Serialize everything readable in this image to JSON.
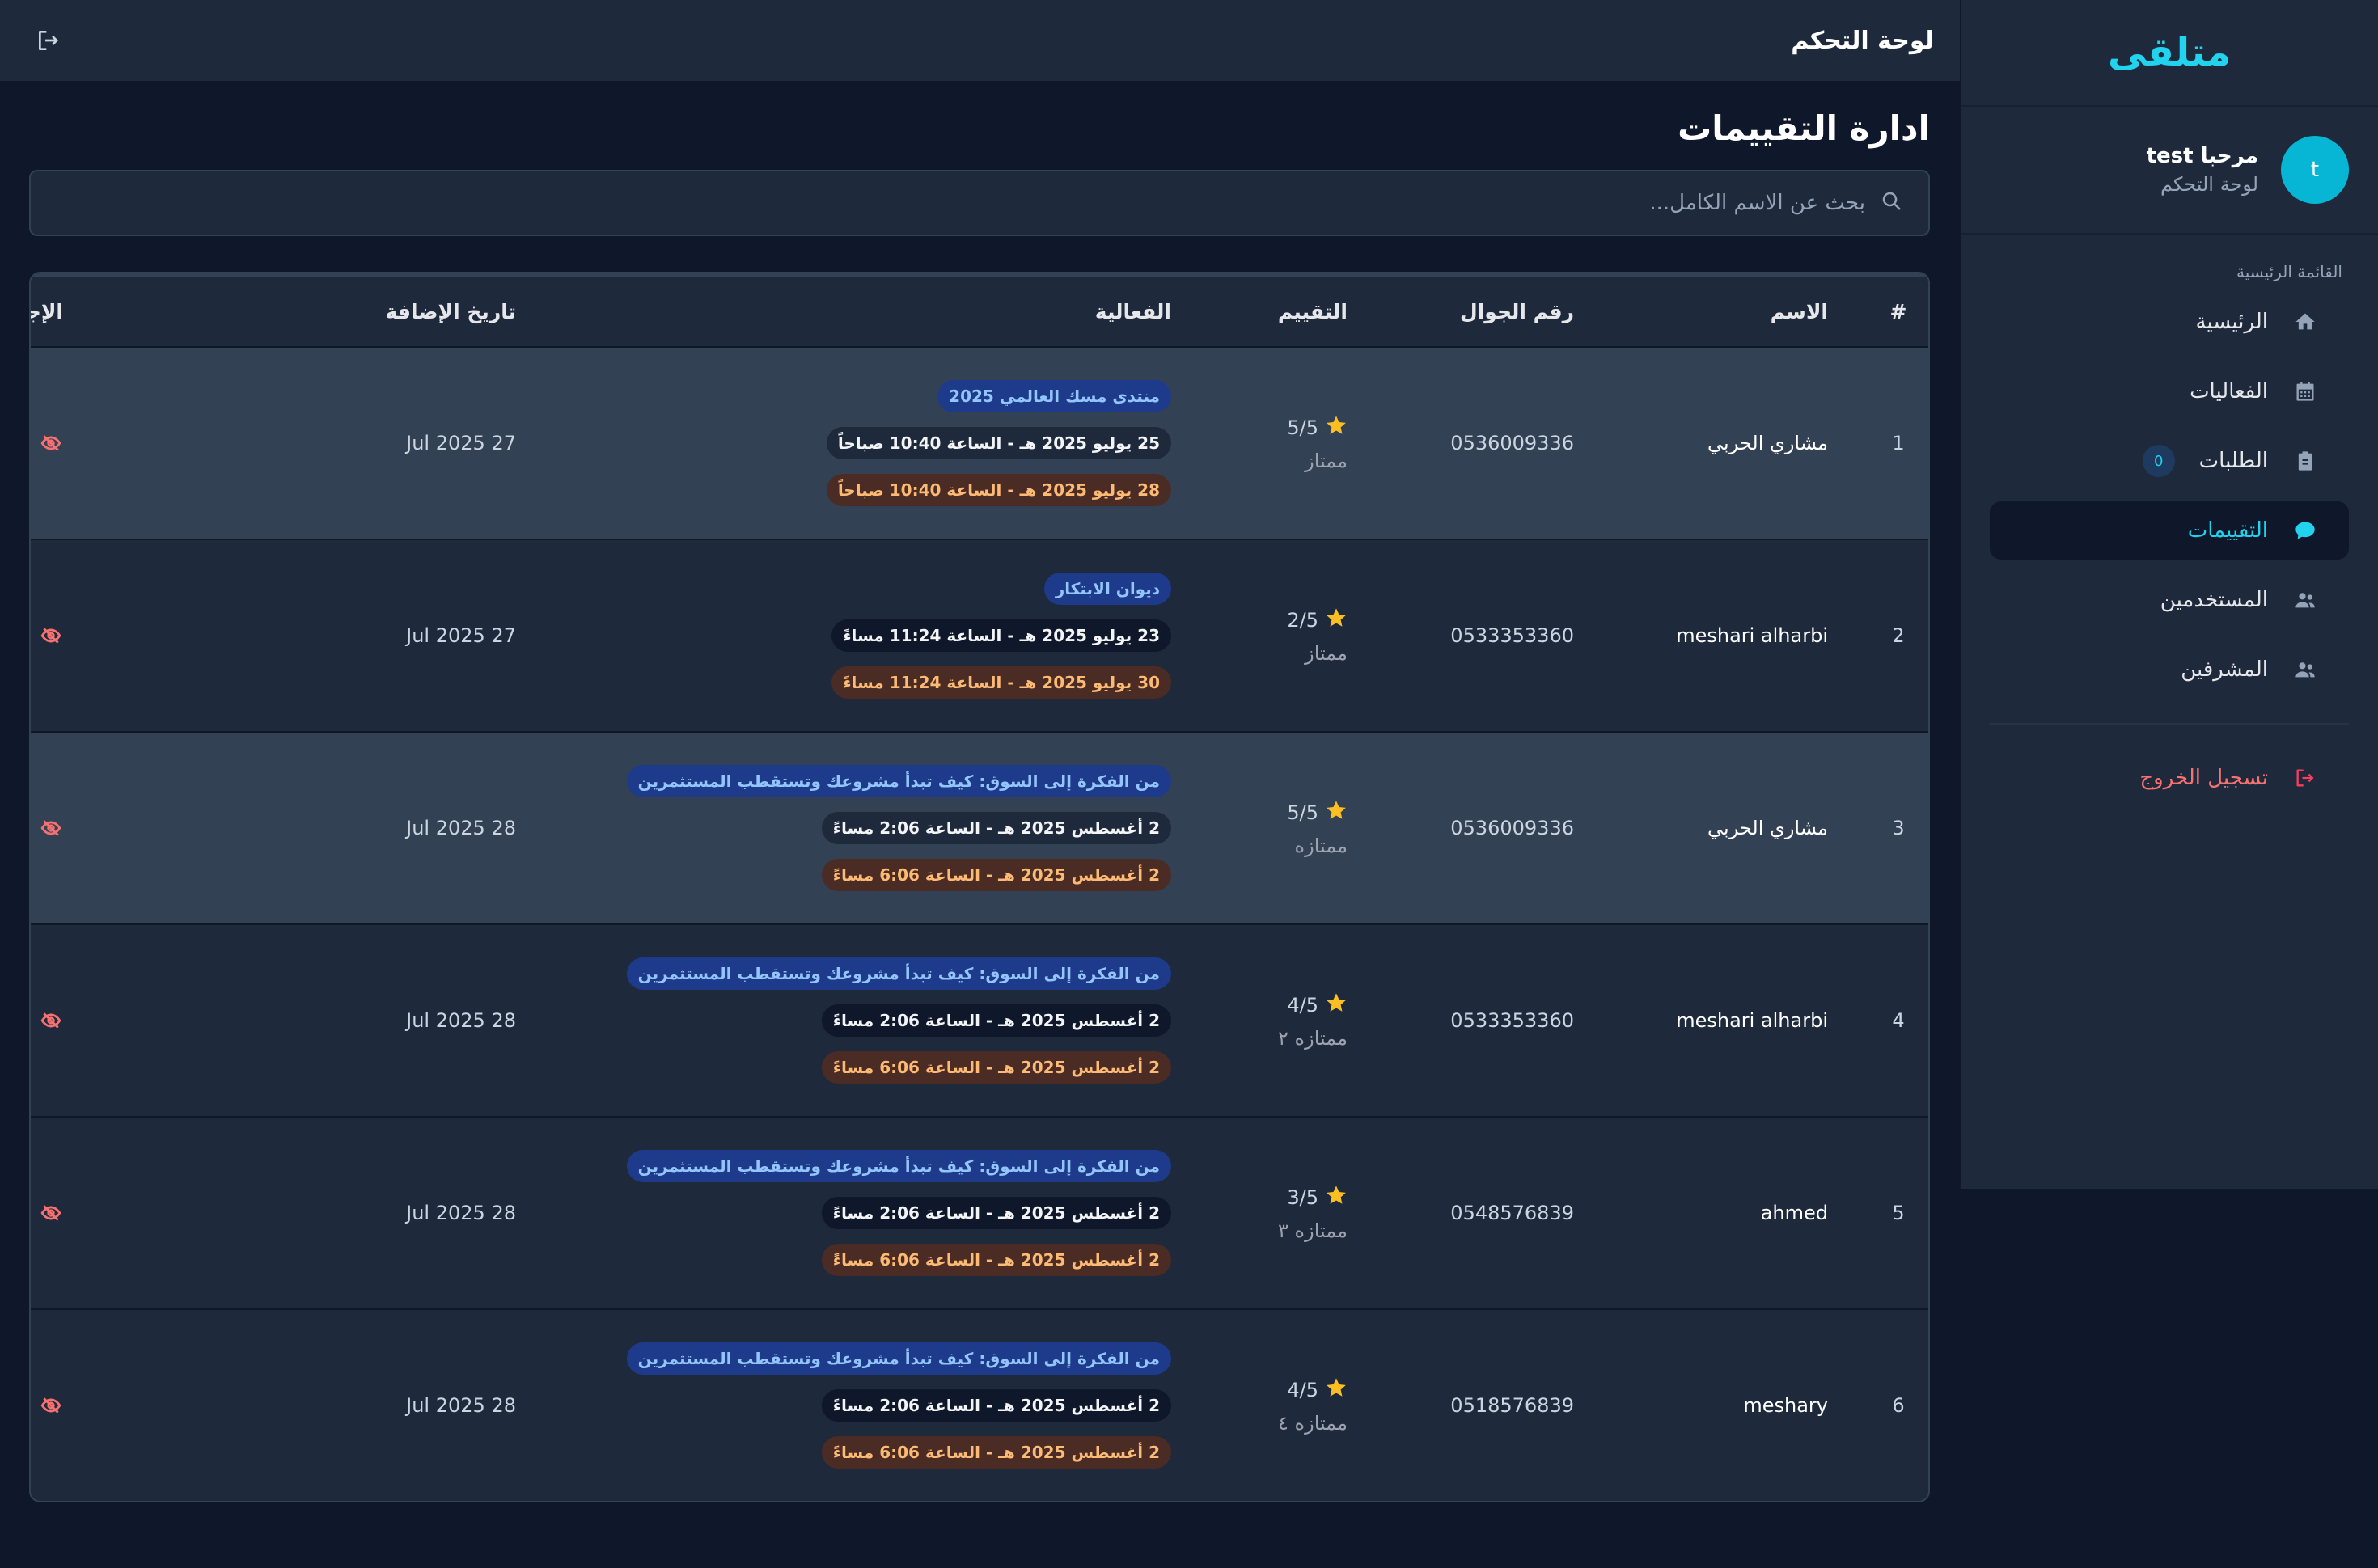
{
  "app": {
    "brand": "متلقى"
  },
  "topbar": {
    "title": "لوحة التحكم",
    "exit_icon": "exit-icon"
  },
  "profile": {
    "avatar_letter": "t",
    "greeting": "مرحبا test",
    "subtitle": "لوحة التحكم"
  },
  "sidebar": {
    "heading": "القائمة الرئيسية",
    "items": [
      {
        "label": "الرئيسية",
        "icon": "home-icon",
        "active": false
      },
      {
        "label": "الفعاليات",
        "icon": "calendar-icon",
        "active": false
      },
      {
        "label": "الطلبات",
        "icon": "clipboard-icon",
        "active": false,
        "badge": "0"
      },
      {
        "label": "التقييمات",
        "icon": "comment-icon",
        "active": true
      },
      {
        "label": "المستخدمين",
        "icon": "users-icon",
        "active": false
      },
      {
        "label": "المشرفين",
        "icon": "users-icon",
        "active": false
      }
    ],
    "logout": "تسجيل الخروج"
  },
  "page": {
    "title": "ادارة التقييمات",
    "search_placeholder": "بحث عن الاسم الكامل..."
  },
  "table": {
    "headers": {
      "num": "#",
      "name": "الاسم",
      "phone": "رقم الجوال",
      "rating": "التقييم",
      "event": "الفعالية",
      "date": "تاريخ الإضافة",
      "actions": "الإجراءات"
    },
    "rows": [
      {
        "num": "1",
        "name": "مشاري الحربي",
        "phone": "0536009336",
        "rating": "5/5",
        "rating_label": "ممتاز",
        "event_title": "منتدى مسك العالمي 2025",
        "event_start": "25 يوليو 2025 هـ - الساعة 10:40 صباحاً",
        "event_end": "28 يوليو 2025 هـ - الساعة 10:40 صباحاً",
        "date": "27 Jul 2025"
      },
      {
        "num": "2",
        "name": "meshari alharbi",
        "phone": "0533353360",
        "rating": "2/5",
        "rating_label": "ممتاز",
        "event_title": "ديوان الابتكار",
        "event_start": "23 يوليو 2025 هـ - الساعة 11:24 مساءً",
        "event_end": "30 يوليو 2025 هـ - الساعة 11:24 مساءً",
        "date": "27 Jul 2025"
      },
      {
        "num": "3",
        "name": "مشاري الحربي",
        "phone": "0536009336",
        "rating": "5/5",
        "rating_label": "ممتازه",
        "event_title": "من الفكرة إلى السوق: كيف تبدأ مشروعك وتستقطب المستثمرين",
        "event_start": "2 أغسطس 2025 هـ - الساعة 2:06 مساءً",
        "event_end": "2 أغسطس 2025 هـ - الساعة 6:06 مساءً",
        "date": "28 Jul 2025"
      },
      {
        "num": "4",
        "name": "meshari alharbi",
        "phone": "0533353360",
        "rating": "4/5",
        "rating_label": "ممتازه ٢",
        "event_title": "من الفكرة إلى السوق: كيف تبدأ مشروعك وتستقطب المستثمرين",
        "event_start": "2 أغسطس 2025 هـ - الساعة 2:06 مساءً",
        "event_end": "2 أغسطس 2025 هـ - الساعة 6:06 مساءً",
        "date": "28 Jul 2025"
      },
      {
        "num": "5",
        "name": "ahmed",
        "phone": "0548576839",
        "rating": "3/5",
        "rating_label": "ممتازه ٣",
        "event_title": "من الفكرة إلى السوق: كيف تبدأ مشروعك وتستقطب المستثمرين",
        "event_start": "2 أغسطس 2025 هـ - الساعة 2:06 مساءً",
        "event_end": "2 أغسطس 2025 هـ - الساعة 6:06 مساءً",
        "date": "28 Jul 2025"
      },
      {
        "num": "6",
        "name": "meshary",
        "phone": "0518576839",
        "rating": "4/5",
        "rating_label": "ممتازه ٤",
        "event_title": "من الفكرة إلى السوق: كيف تبدأ مشروعك وتستقطب المستثمرين",
        "event_start": "2 أغسطس 2025 هـ - الساعة 2:06 مساءً",
        "event_end": "2 أغسطس 2025 هـ - الساعة 6:06 مساءً",
        "date": "28 Jul 2025"
      }
    ]
  },
  "colors": {
    "accent": "#22d3ee",
    "danger": "#f87171",
    "star": "#fbbf24",
    "background": "#0f172a",
    "panel": "#1e293b"
  }
}
